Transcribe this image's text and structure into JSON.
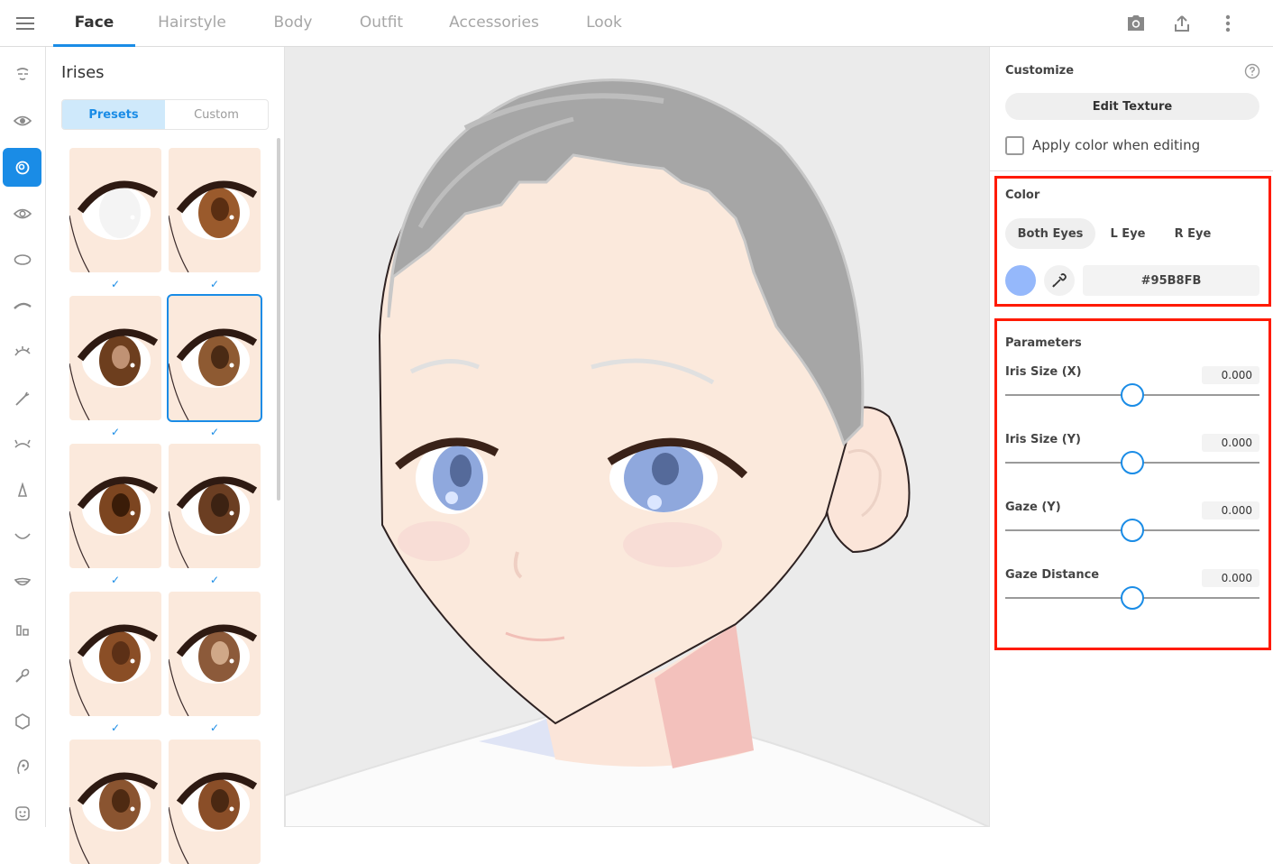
{
  "colors": {
    "accent": "#1a8ce6",
    "highlight": "#ff1a00",
    "iris_color": "#95B8FB"
  },
  "top_nav": {
    "tabs": [
      {
        "label": "Face",
        "active": true
      },
      {
        "label": "Hairstyle",
        "active": false
      },
      {
        "label": "Body",
        "active": false
      },
      {
        "label": "Outfit",
        "active": false
      },
      {
        "label": "Accessories",
        "active": false
      },
      {
        "label": "Look",
        "active": false
      }
    ],
    "icons": [
      "hamburger-menu-icon",
      "camera-icon",
      "share-icon",
      "more-vert-icon"
    ]
  },
  "sidebar": {
    "items": [
      {
        "icon": "face-shape-icon",
        "active": false
      },
      {
        "icon": "eye-icon",
        "active": false
      },
      {
        "icon": "iris-icon",
        "active": true
      },
      {
        "icon": "eye-white-icon",
        "active": false
      },
      {
        "icon": "eye-outline-icon",
        "active": false
      },
      {
        "icon": "eyebrow-icon",
        "active": false
      },
      {
        "icon": "eyelash-icon",
        "active": false
      },
      {
        "icon": "eye-highlight-icon",
        "active": false
      },
      {
        "icon": "lower-lash-icon",
        "active": false
      },
      {
        "icon": "nose-icon",
        "active": false
      },
      {
        "icon": "mouth-icon",
        "active": false
      },
      {
        "icon": "teeth-icon",
        "active": false
      },
      {
        "icon": "cheek-icon",
        "active": false
      },
      {
        "icon": "makeup-brush-icon",
        "active": false
      },
      {
        "icon": "face-outline-icon",
        "active": false
      },
      {
        "icon": "ear-icon",
        "active": false
      },
      {
        "icon": "expression-icon",
        "active": false
      }
    ]
  },
  "irises_panel": {
    "title": "Irises",
    "segments": [
      {
        "label": "Presets",
        "active": true
      },
      {
        "label": "Custom",
        "active": false
      }
    ],
    "check_mark": "✓",
    "presets": [
      {
        "iris": "#f4f4f4",
        "pupil": "#f4f4f4",
        "selected": false,
        "checked": true
      },
      {
        "iris": "#9a5a2c",
        "pupil": "#5a2e12",
        "selected": false,
        "checked": true
      },
      {
        "iris": "#6d3e1e",
        "pupil": "#c09274",
        "selected": false,
        "checked": true
      },
      {
        "iris": "#8e5a32",
        "pupil": "#4a2a14",
        "selected": true,
        "checked": true
      },
      {
        "iris": "#7c4520",
        "pupil": "#3a1c08",
        "selected": false,
        "checked": true
      },
      {
        "iris": "#6b3e22",
        "pupil": "#3c2212",
        "selected": false,
        "checked": true
      },
      {
        "iris": "#8a4e26",
        "pupil": "#5c3016",
        "selected": false,
        "checked": true
      },
      {
        "iris": "#8c5a3a",
        "pupil": "#d0a888",
        "selected": false,
        "checked": true
      },
      {
        "iris": "#8a5430",
        "pupil": "#4e2a12",
        "selected": false,
        "checked": false
      },
      {
        "iris": "#8a4e28",
        "pupil": "#4a2812",
        "selected": false,
        "checked": false
      }
    ]
  },
  "customize": {
    "title": "Customize",
    "edit_texture_label": "Edit Texture",
    "apply_color_label": "Apply color when editing",
    "apply_color_checked": false
  },
  "color_section": {
    "title": "Color",
    "eye_tabs": [
      {
        "label": "Both Eyes",
        "active": true
      },
      {
        "label": "L Eye",
        "active": false
      },
      {
        "label": "R Eye",
        "active": false
      }
    ],
    "hex_value": "#95B8FB"
  },
  "parameters": {
    "title": "Parameters",
    "items": [
      {
        "label": "Iris Size (X)",
        "value": "0.000",
        "position": 0.5
      },
      {
        "label": "Iris Size (Y)",
        "value": "0.000",
        "position": 0.5
      },
      {
        "label": "Gaze (Y)",
        "value": "0.000",
        "position": 0.5
      },
      {
        "label": "Gaze Distance",
        "value": "0.000",
        "position": 0.5
      }
    ]
  }
}
